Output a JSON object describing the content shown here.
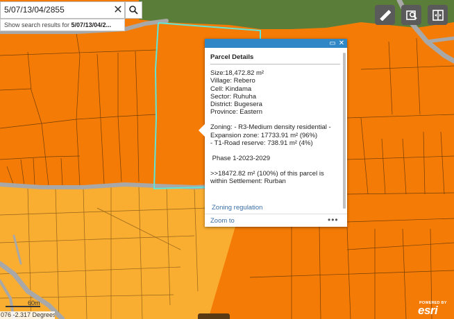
{
  "search": {
    "value": "5/07/13/04/2855",
    "suggestion_prefix": "Show search results for ",
    "suggestion_query": "5/07/13/04/2..."
  },
  "toolbar": {
    "icons": [
      "measure-icon",
      "query-icon",
      "layer-swipe-icon"
    ]
  },
  "popup": {
    "title": "Parcel Details",
    "lines_block1": [
      "Size:18,472.82 m²",
      "Village: Rebero",
      "Cell: Kindama",
      "Sector: Ruhuha",
      "District: Bugesera",
      "Province: Eastern"
    ],
    "zoning": [
      "Zoning:   - R3-Medium density residential -",
      "Expansion zone: 17733.91 m² (96%)",
      "- T1-Road reserve: 738.91 m² (4%)"
    ],
    "phase": " Phase 1-2023-2029",
    "settlement": [
      ">>18472.82 m² (100%) of this parcel is",
      "within Settlement: Rurban"
    ],
    "zoning_link": "Zoning regulation",
    "zoom_to": "Zoom to",
    "more": "•••"
  },
  "map": {
    "coordinates": "076 -2.317 Degrees",
    "scale_label": "60m",
    "attribution_powered": "POWERED BY",
    "attribution_brand": "esri"
  },
  "colors": {
    "expansion_zone": "#f47b06",
    "settlement_zone": "#f9ad31",
    "green_area": "#5a7e3a",
    "road": "#a8a8a8",
    "parcel_highlight": "#5fe6d8",
    "popup_header": "#2f87c6"
  }
}
